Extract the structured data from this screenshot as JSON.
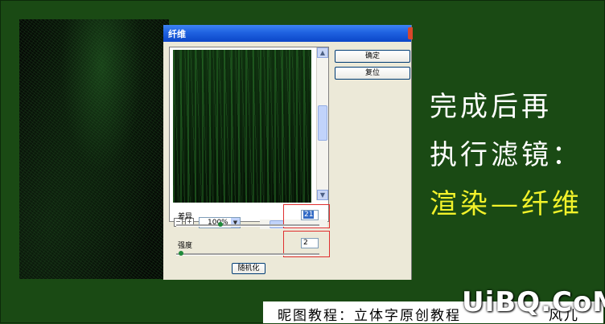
{
  "dialog": {
    "title": "纤维",
    "ok_label": "确定",
    "reset_label": "复位",
    "zoom_value": "100%",
    "zoom_minus": "−",
    "zoom_plus": "+",
    "variance_label": "差异",
    "variance_value": "21",
    "variance_level": 0.3,
    "strength_label": "强度",
    "strength_value": "2",
    "strength_level": 0.02,
    "randomize_label": "随机化"
  },
  "side_text": {
    "line1": "完成后再",
    "line2": "执行滤镜：",
    "line3": "渲染—纤维"
  },
  "caption": {
    "text": "昵图教程：立体字原创教程",
    "author": "风儿"
  },
  "watermark": "UiBQ.CoM",
  "colors": {
    "background": "#1a4a14",
    "side_text_white": "#ffffff",
    "side_text_highlight": "#f2f22a",
    "highlight_box": "#e03030"
  }
}
